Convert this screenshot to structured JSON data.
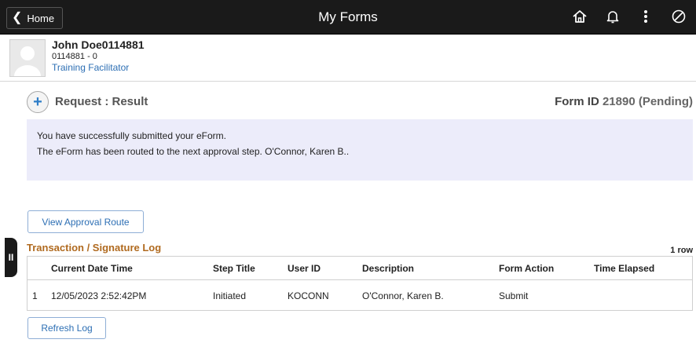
{
  "header": {
    "back_label": "Home",
    "title": "My Forms",
    "icons": [
      "home-icon",
      "bell-icon",
      "more-vertical-icon",
      "no-entry-icon"
    ]
  },
  "user": {
    "name": "John Doe0114881",
    "id_line": "0114881 - 0",
    "role": "Training Facilitator"
  },
  "request": {
    "title": "Request : Result",
    "form_id_label": "Form ID",
    "form_id_value": "21890 (Pending)"
  },
  "messages": {
    "line1": "You have successfully submitted your eForm.",
    "line2": "The eForm has been routed to the next approval step.  O'Connor, Karen B.."
  },
  "buttons": {
    "view_approval_route": "View Approval Route",
    "refresh_log": "Refresh Log"
  },
  "log": {
    "title": "Transaction / Signature Log",
    "row_count": "1 row",
    "columns": [
      "Current Date Time",
      "Step Title",
      "User ID",
      "Description",
      "Form Action",
      "Time Elapsed"
    ],
    "rows": [
      {
        "num": "1",
        "datetime": "12/05/2023  2:52:42PM",
        "step_title": "Initiated",
        "user_id": "KOCONN",
        "description": "O'Connor, Karen B.",
        "form_action": "Submit",
        "time_elapsed": ""
      }
    ]
  },
  "side_handle_label": "II",
  "colors": {
    "topbar": "#1a1a1a",
    "link_blue": "#2d6fb4",
    "message_bg": "#ececfa",
    "log_title": "#b06a1f"
  }
}
